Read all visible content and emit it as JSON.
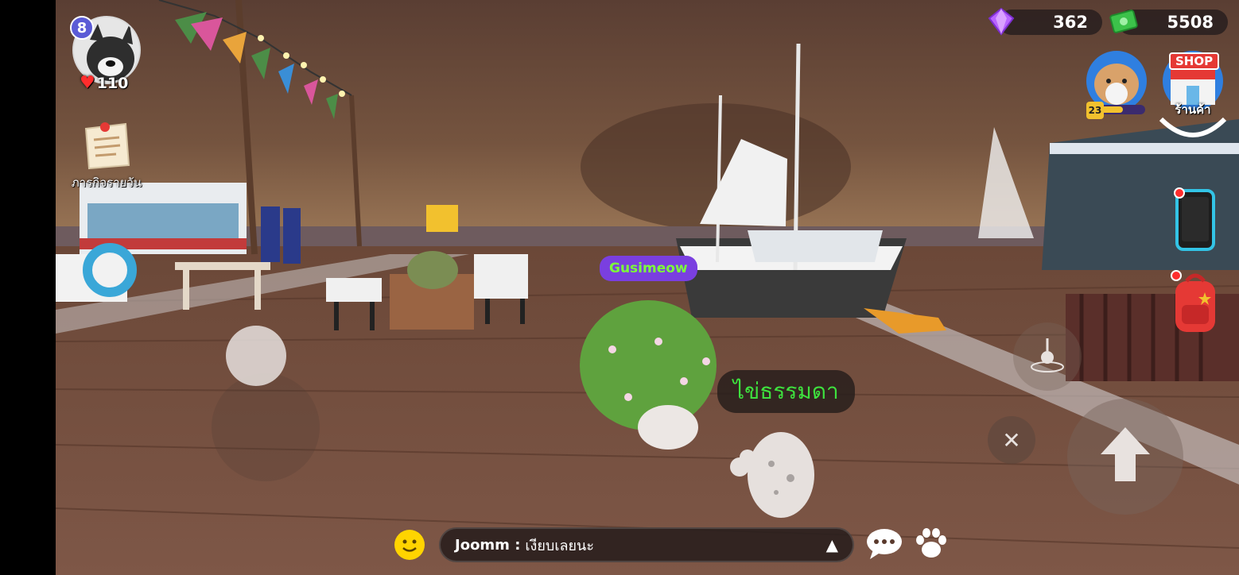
{
  "player": {
    "level": "8",
    "hp": "110"
  },
  "quest": {
    "label": "ภารกิจรายวัน"
  },
  "currency": {
    "gems": "362",
    "cash": "5508"
  },
  "pet": {
    "level": "23"
  },
  "shop": {
    "badge": "SHOP",
    "label": "ร้านค้า"
  },
  "world": {
    "nametag": "Gusimeow",
    "item_label": "ไข่ธรรมดา"
  },
  "controls": {
    "close": "✕"
  },
  "chat": {
    "sender": "Joomm :",
    "message": "เงียบเลยนะ",
    "expand_icon": "▲"
  },
  "colors": {
    "sky": "#6a4a3a",
    "dock": "#7a5443",
    "nametag_bg": "#7a3fe0",
    "nametag_text": "#7cff3a",
    "item_text": "#3ee13e",
    "gem": "#b964ff",
    "cash": "#3cc24a"
  },
  "icons": {
    "emoji": "smiley-icon",
    "chat": "chat-bubble-icon",
    "pets": "paw-icon",
    "phone": "phone-icon",
    "bag": "backpack-icon",
    "jump": "up-arrow-icon",
    "fish": "fishing-icon"
  }
}
